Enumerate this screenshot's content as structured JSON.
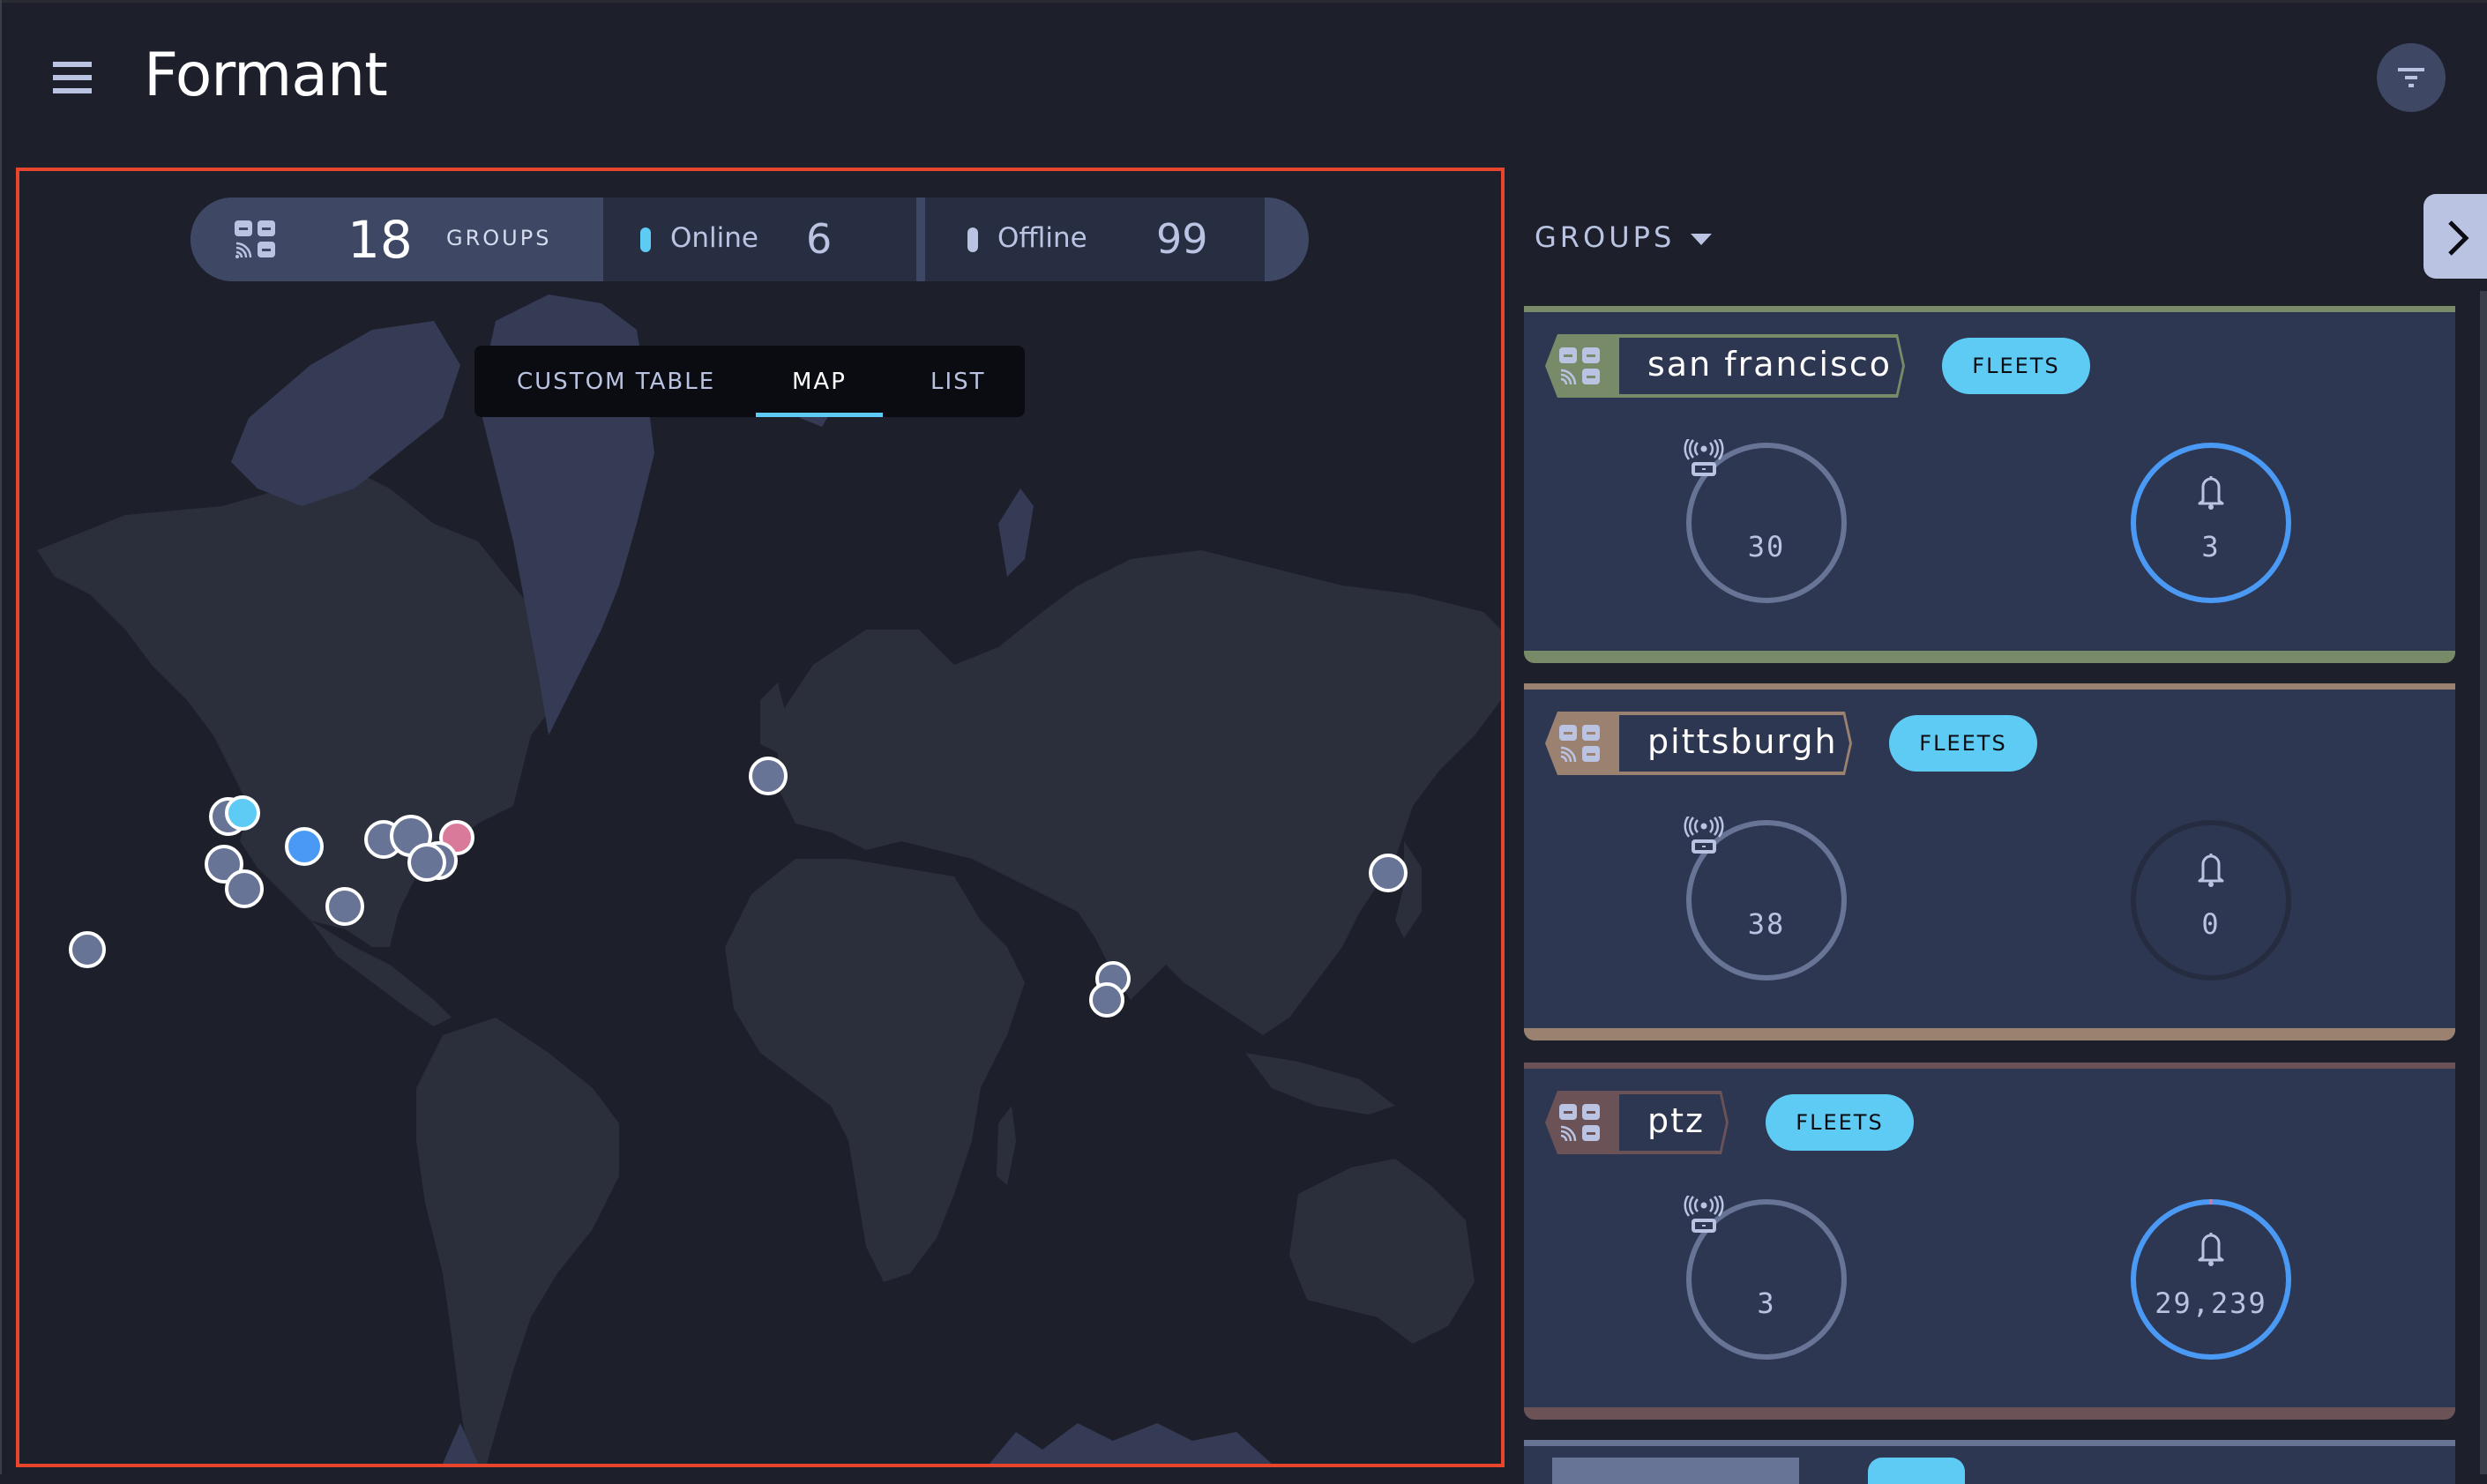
{
  "app": {
    "title": "Formant",
    "menu_icon": "hamburger-icon",
    "filter_icon": "filter-icon"
  },
  "stats_bar": {
    "groups_icon": "groups-icon",
    "groups_count": "18",
    "groups_label": "GROUPS",
    "online_label": "Online",
    "online_count": "6",
    "online_color": "#5ecbf5",
    "offline_label": "Offline",
    "offline_count": "99",
    "offline_color": "#bac4e2"
  },
  "view_tabs": {
    "items": [
      {
        "label": "CUSTOM TABLE",
        "active": false
      },
      {
        "label": "MAP",
        "active": true
      },
      {
        "label": "LIST",
        "active": false
      }
    ]
  },
  "map": {
    "markers": [
      {
        "location": "Hawaii",
        "status": "offline",
        "color": "#687495"
      },
      {
        "location": "San Francisco",
        "status": "offline",
        "color": "#687495"
      },
      {
        "location": "San Francisco",
        "status": "online",
        "color": "#5ecbf5"
      },
      {
        "location": "Los Angeles",
        "status": "offline",
        "color": "#687495"
      },
      {
        "location": "Los Angeles",
        "status": "offline",
        "color": "#687495"
      },
      {
        "location": "Denver",
        "status": "active",
        "color": "#4a9af5"
      },
      {
        "location": "Texas",
        "status": "offline",
        "color": "#687495"
      },
      {
        "location": "Chicago",
        "status": "offline",
        "color": "#687495"
      },
      {
        "location": "Detroit",
        "status": "offline",
        "color": "#687495"
      },
      {
        "location": "Pittsburgh",
        "status": "offline",
        "color": "#687495"
      },
      {
        "location": "East Coast",
        "status": "alert",
        "color": "#d97a9a"
      },
      {
        "location": "East Coast",
        "status": "offline",
        "color": "#687495"
      },
      {
        "location": "London",
        "status": "offline",
        "color": "#687495"
      },
      {
        "location": "India",
        "status": "offline",
        "color": "#687495"
      },
      {
        "location": "India",
        "status": "offline",
        "color": "#687495"
      },
      {
        "location": "Japan",
        "status": "offline",
        "color": "#687495"
      }
    ]
  },
  "groups_panel": {
    "header": "GROUPS",
    "dropdown_icon": "caret-down-icon",
    "collapse_icon": "chevron-right-icon",
    "cards": [
      {
        "name": "san francisco",
        "accent": "#788a67",
        "tag_button": "FLEETS",
        "devices": "30",
        "alerts": "3",
        "alerts_ring_color": "#4a9af5",
        "alerts_ring_fraction_critical": 0
      },
      {
        "name": "pittsburgh",
        "accent": "#9b8170",
        "tag_button": "FLEETS",
        "devices": "38",
        "alerts": "0",
        "alerts_ring_color": "#262c40",
        "alerts_ring_fraction_critical": 0
      },
      {
        "name": "ptz",
        "accent": "#6a5257",
        "tag_button": "FLEETS",
        "devices": "3",
        "alerts": "29,239",
        "alerts_ring_color": "#4a9af5",
        "alerts_ring_fraction_critical": 0.005
      }
    ],
    "partial_card_accent": "#687495"
  }
}
